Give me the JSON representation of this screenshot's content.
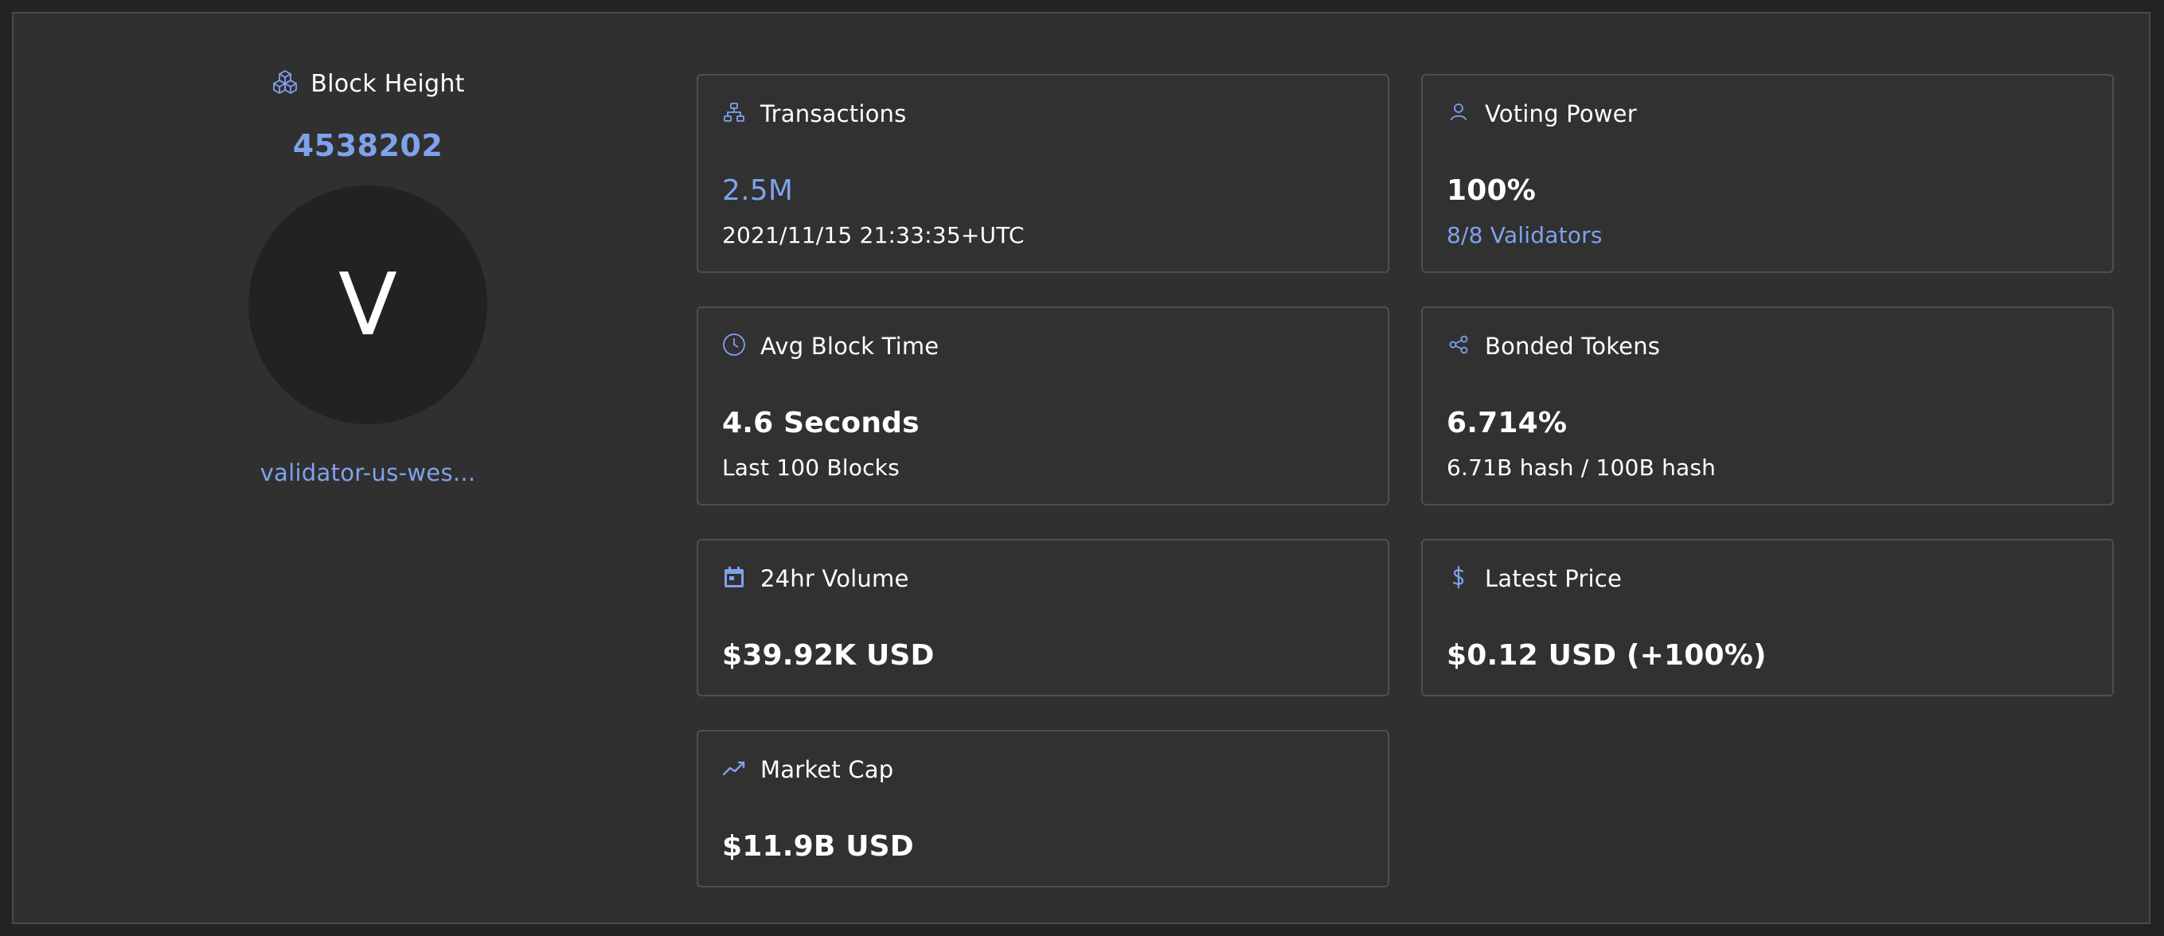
{
  "accent_color": "#7fa2ec",
  "block_height": {
    "label": "Block Height",
    "value": "4538202",
    "icon": "cubes-icon"
  },
  "validator": {
    "avatar_letter": "V",
    "moniker": "validator-us-wes..."
  },
  "cards": {
    "transactions": {
      "icon": "sitemap-icon",
      "title": "Transactions",
      "value": "2.5M",
      "sub": "2021/11/15 21:33:35+UTC"
    },
    "voting_power": {
      "icon": "user-icon",
      "title": "Voting Power",
      "value": "100%",
      "sub": "8/8 Validators"
    },
    "avg_block_time": {
      "icon": "clock-icon",
      "title": "Avg Block Time",
      "value": "4.6 Seconds",
      "sub": "Last 100 Blocks"
    },
    "bonded_tokens": {
      "icon": "share-nodes-icon",
      "title": "Bonded Tokens",
      "value": "6.714%",
      "sub": "6.71B hash / 100B hash"
    },
    "volume": {
      "icon": "calendar-icon",
      "title": "24hr Volume",
      "value": "$39.92K USD"
    },
    "latest_price": {
      "icon": "dollar-icon",
      "title": "Latest Price",
      "value": "$0.12 USD (+100%)"
    },
    "market_cap": {
      "icon": "trend-line-icon",
      "title": "Market Cap",
      "value": "$11.9B USD"
    }
  }
}
